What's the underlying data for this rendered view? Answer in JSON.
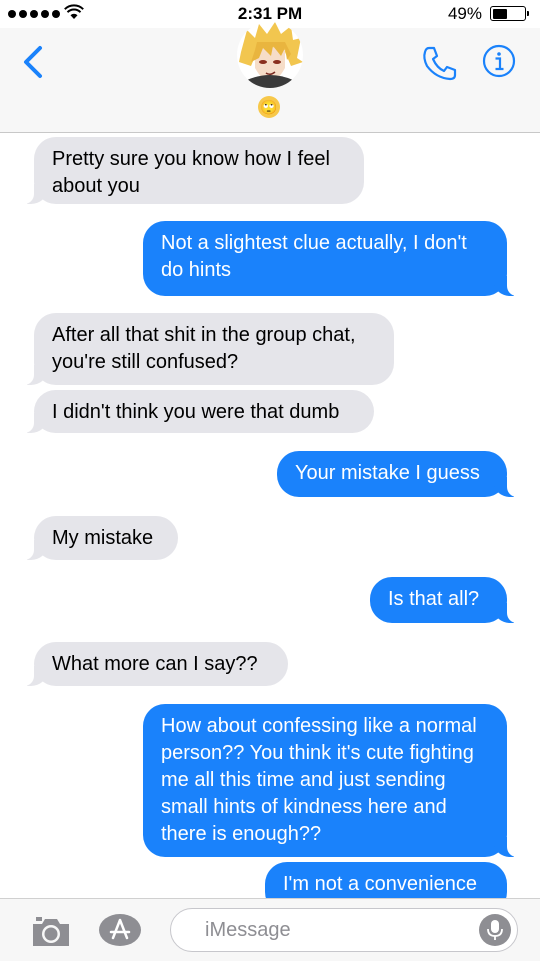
{
  "status_bar": {
    "time": "2:31 PM",
    "battery": "49%",
    "battery_level": 0.49
  },
  "header": {
    "contact_emoji": "🙄",
    "icons": {
      "back": "chevron-left-icon",
      "call": "phone-icon",
      "info": "info-icon"
    },
    "accent_color": "#1a82fb"
  },
  "messages": [
    {
      "direction": "received",
      "text": "Pretty sure you know how I feel about you"
    },
    {
      "direction": "sent",
      "text": "Not a slightest clue actually, I don't do hints"
    },
    {
      "direction": "received",
      "text": "After all that shit in the group chat, you're still confused?"
    },
    {
      "direction": "received",
      "text": "I didn't think you were that dumb"
    },
    {
      "direction": "sent",
      "text": "Your mistake I guess"
    },
    {
      "direction": "received",
      "text": "My mistake"
    },
    {
      "direction": "sent",
      "text": "Is that all?"
    },
    {
      "direction": "received",
      "text": "What more can I say??"
    },
    {
      "direction": "sent",
      "text": "How about confessing like a normal person?? You think it's cute fighting me all this time and just sending small hints of kindness here and there is enough??"
    },
    {
      "direction": "sent",
      "text": "I'm not a convenience"
    }
  ],
  "composer": {
    "placeholder": "iMessage",
    "icons": [
      "camera-icon",
      "app-store-icon",
      "microphone-icon"
    ]
  }
}
